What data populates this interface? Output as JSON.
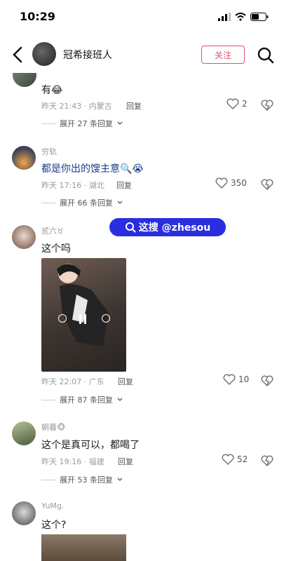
{
  "status": {
    "time": "10:29"
  },
  "header": {
    "title": "冠希接班人",
    "follow_label": "关注"
  },
  "watermark": {
    "text": "这搜 @zhesou"
  },
  "comments": [
    {
      "name": "",
      "text": "有😂",
      "time": "昨天 21:43",
      "location": "内蒙古",
      "reply_label": "回复",
      "likes": "2",
      "expand": "展开 27 条回复"
    },
    {
      "name": "穷轨",
      "text": "都是你出的馊主意🔍😭",
      "time": "昨天 17:16",
      "location": "湖北",
      "reply_label": "回复",
      "likes": "350",
      "expand": "展开 66 条回复"
    },
    {
      "name": "贰六♉",
      "text": "这个吗",
      "time": "昨天 22:07",
      "location": "广东",
      "reply_label": "回复",
      "likes": "10",
      "expand": "展开 87 条回复"
    },
    {
      "name": "朝暮🐵",
      "text": "这个是真可以，都喝了",
      "time": "昨天 19:16",
      "location": "福建",
      "reply_label": "回复",
      "likes": "52",
      "expand": "展开 53 条回复"
    },
    {
      "name": "YuMg.",
      "text": "这个?",
      "time": "",
      "location": "",
      "reply_label": "",
      "likes": "",
      "expand": ""
    }
  ]
}
